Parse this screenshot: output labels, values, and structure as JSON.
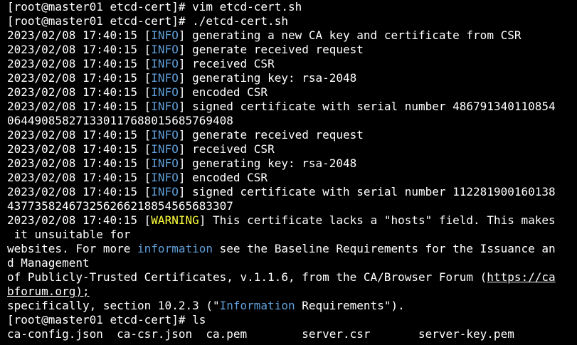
{
  "terminal": {
    "lines": [
      {
        "kind": "prompt",
        "prompt": "[root@master01 etcd-cert]# ",
        "command": "vim etcd-cert.sh"
      },
      {
        "kind": "prompt",
        "prompt": "[root@master01 etcd-cert]# ",
        "command": "./etcd-cert.sh"
      },
      {
        "kind": "log",
        "timestamp": "2023/02/08 17:40:15 ",
        "level": "INFO",
        "message": " generating a new CA key and certificate from CSR"
      },
      {
        "kind": "log",
        "timestamp": "2023/02/08 17:40:15 ",
        "level": "INFO",
        "message": " generate received request"
      },
      {
        "kind": "log",
        "timestamp": "2023/02/08 17:40:15 ",
        "level": "INFO",
        "message": " received CSR"
      },
      {
        "kind": "log",
        "timestamp": "2023/02/08 17:40:15 ",
        "level": "INFO",
        "message": " generating key: rsa-2048"
      },
      {
        "kind": "log",
        "timestamp": "2023/02/08 17:40:15 ",
        "level": "INFO",
        "message": " encoded CSR"
      },
      {
        "kind": "log",
        "timestamp": "2023/02/08 17:40:15 ",
        "level": "INFO",
        "message": " signed certificate with serial number 486791340110854"
      },
      {
        "kind": "plain",
        "text": "064490858271330117688015685769408"
      },
      {
        "kind": "log",
        "timestamp": "2023/02/08 17:40:15 ",
        "level": "INFO",
        "message": " generate received request"
      },
      {
        "kind": "log",
        "timestamp": "2023/02/08 17:40:15 ",
        "level": "INFO",
        "message": " received CSR"
      },
      {
        "kind": "log",
        "timestamp": "2023/02/08 17:40:15 ",
        "level": "INFO",
        "message": " generating key: rsa-2048"
      },
      {
        "kind": "log",
        "timestamp": "2023/02/08 17:40:15 ",
        "level": "INFO",
        "message": " encoded CSR"
      },
      {
        "kind": "log",
        "timestamp": "2023/02/08 17:40:15 ",
        "level": "INFO",
        "message": " signed certificate with serial number 112281900160138"
      },
      {
        "kind": "plain",
        "text": "437735824673256266218854565683307"
      },
      {
        "kind": "warn",
        "timestamp": "2023/02/08 17:40:15 ",
        "level": "WARNING",
        "message": " This certificate lacks a \"hosts\" field. This makes"
      },
      {
        "kind": "plain",
        "text": " it unsuitable for"
      },
      {
        "kind": "mixed",
        "parts": [
          {
            "text": "websites. For more ",
            "style": "plain"
          },
          {
            "text": "information",
            "style": "info"
          },
          {
            "text": " see the Baseline Requirements for the Issuance an",
            "style": "plain"
          }
        ]
      },
      {
        "kind": "plain",
        "text": "d Management"
      },
      {
        "kind": "mixed",
        "parts": [
          {
            "text": "of Publicly-Trusted Certificates, v.1.1.6, from the CA/Browser Forum (",
            "style": "plain"
          },
          {
            "text": "https://ca",
            "style": "link"
          }
        ]
      },
      {
        "kind": "mixed",
        "parts": [
          {
            "text": "bforum.org);",
            "style": "link"
          }
        ]
      },
      {
        "kind": "mixed",
        "parts": [
          {
            "text": "specifically, section 10.2.3 (\"",
            "style": "plain"
          },
          {
            "text": "Information",
            "style": "info"
          },
          {
            "text": " Requirements\").",
            "style": "plain"
          }
        ]
      },
      {
        "kind": "prompt",
        "prompt": "[root@master01 etcd-cert]# ",
        "command": "ls"
      },
      {
        "kind": "plain",
        "text": "ca-config.json  ca-csr.json  ca.pem        server.csr       server-key.pem"
      }
    ]
  }
}
